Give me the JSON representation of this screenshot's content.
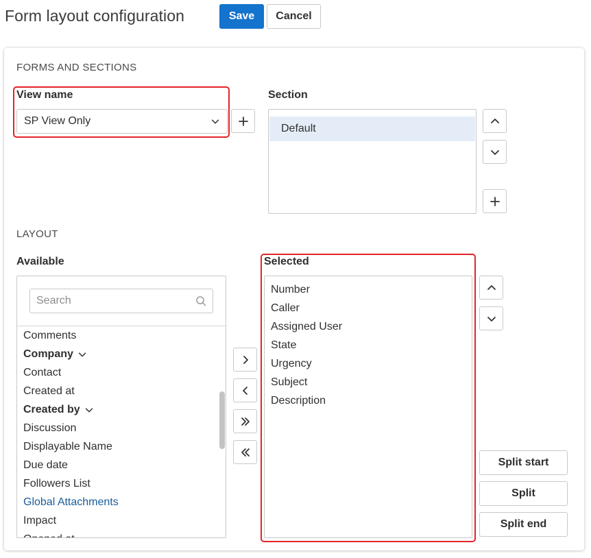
{
  "header": {
    "title": "Form layout configuration",
    "save_label": "Save",
    "cancel_label": "Cancel"
  },
  "forms_sections": {
    "heading": "FORMS AND SECTIONS",
    "view_name_label": "View name",
    "view_name_value": "SP View Only",
    "section_label": "Section",
    "sections": [
      "Default"
    ]
  },
  "layout": {
    "heading": "LAYOUT",
    "available_label": "Available",
    "search_placeholder": "Search",
    "available_items": [
      {
        "label": "Comments",
        "style": "normal"
      },
      {
        "label": "Company",
        "style": "bold-expand"
      },
      {
        "label": "Contact",
        "style": "normal"
      },
      {
        "label": "Created at",
        "style": "normal"
      },
      {
        "label": "Created by",
        "style": "bold-expand"
      },
      {
        "label": "Discussion",
        "style": "normal"
      },
      {
        "label": "Displayable Name",
        "style": "normal"
      },
      {
        "label": "Due date",
        "style": "normal"
      },
      {
        "label": "Followers List",
        "style": "normal"
      },
      {
        "label": "Global Attachments",
        "style": "link"
      },
      {
        "label": "Impact",
        "style": "normal"
      },
      {
        "label": "Opened at",
        "style": "normal"
      }
    ],
    "selected_label": "Selected",
    "selected_items": [
      "Number",
      "Caller",
      "Assigned User",
      "State",
      "Urgency",
      "Subject",
      "Description"
    ],
    "split_start_label": "Split start",
    "split_label": "Split",
    "split_end_label": "Split end"
  },
  "colors": {
    "primary": "#1473cc",
    "highlight": "#e32228",
    "selected_row": "#e4edf7",
    "link": "#1a5c99"
  }
}
